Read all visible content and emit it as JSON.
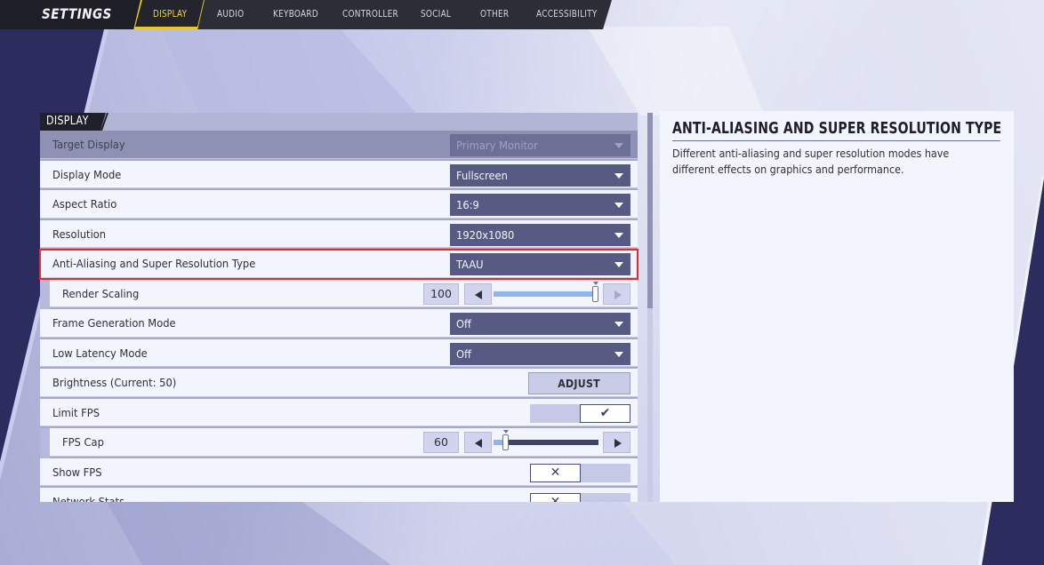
{
  "app": {
    "title": "SETTINGS"
  },
  "tabs": [
    {
      "label": "DISPLAY",
      "active": true
    },
    {
      "label": "AUDIO",
      "active": false
    },
    {
      "label": "KEYBOARD",
      "active": false
    },
    {
      "label": "CONTROLLER",
      "active": false
    },
    {
      "label": "SOCIAL",
      "active": false
    },
    {
      "label": "OTHER",
      "active": false
    },
    {
      "label": "ACCESSIBILITY",
      "active": false
    }
  ],
  "section": {
    "title": "DISPLAY"
  },
  "settings": {
    "target_display": {
      "label": "Target Display",
      "value": "Primary Monitor",
      "disabled": true
    },
    "display_mode": {
      "label": "Display Mode",
      "value": "Fullscreen"
    },
    "aspect_ratio": {
      "label": "Aspect Ratio",
      "value": "16:9"
    },
    "resolution": {
      "label": "Resolution",
      "value": "1920x1080"
    },
    "anti_aliasing": {
      "label": "Anti-Aliasing and Super Resolution Type",
      "value": "TAAU",
      "highlighted": true
    },
    "render_scaling": {
      "label": "Render Scaling",
      "value": "100",
      "fill_percent": 100
    },
    "frame_generation": {
      "label": "Frame Generation Mode",
      "value": "Off"
    },
    "low_latency": {
      "label": "Low Latency Mode",
      "value": "Off"
    },
    "brightness": {
      "label": "Brightness (Current: 50)",
      "button": "ADJUST"
    },
    "limit_fps": {
      "label": "Limit FPS",
      "state": "on",
      "glyph": "✔"
    },
    "fps_cap": {
      "label": "FPS Cap",
      "value": "60",
      "fill_percent": 12
    },
    "show_fps": {
      "label": "Show FPS",
      "state": "off",
      "glyph": "✕"
    },
    "network_stats": {
      "label": "Network Stats",
      "state": "off",
      "glyph": "✕"
    }
  },
  "description": {
    "title": "ANTI-ALIASING AND SUPER RESOLUTION TYPE",
    "text": "Different anti-aliasing and super resolution modes have different effects on graphics and performance."
  },
  "colors": {
    "accent_yellow": "#f1d43a",
    "highlight_red": "#ea2a2a",
    "dropdown_bg": "#575a82",
    "slider_fill": "#8fb6ea"
  }
}
